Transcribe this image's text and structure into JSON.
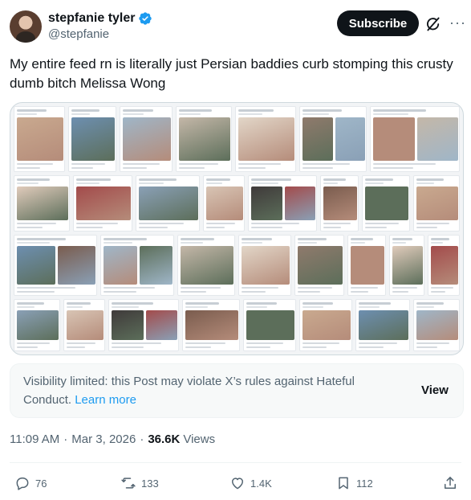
{
  "author": {
    "display_name": "stepfanie tyler",
    "handle": "@stepfanie",
    "verified_icon": "verified-badge-icon"
  },
  "header": {
    "subscribe_label": "Subscribe",
    "grok_icon": "grok-icon",
    "more_icon": "more-icon"
  },
  "tweet": {
    "text": "My entire feed rn is literally just Persian baddies curb stomping this crusty dumb bitch Melissa Wong"
  },
  "media": {
    "description_icon": "collage-image"
  },
  "notice": {
    "text": "Visibility limited: this Post may violate X’s rules against Hateful Conduct.",
    "learn_more": "Learn more",
    "view_label": "View"
  },
  "meta": {
    "time": "11:09 AM",
    "date": "Mar 3, 2026",
    "views_count": "36.6K",
    "views_label": "Views"
  },
  "actions": {
    "replies": "76",
    "reposts": "133",
    "likes": "1.4K",
    "bookmarks": "112"
  },
  "colors": {
    "accent": "#1d9bf0",
    "text": "#0f1419",
    "secondary": "#536471"
  }
}
